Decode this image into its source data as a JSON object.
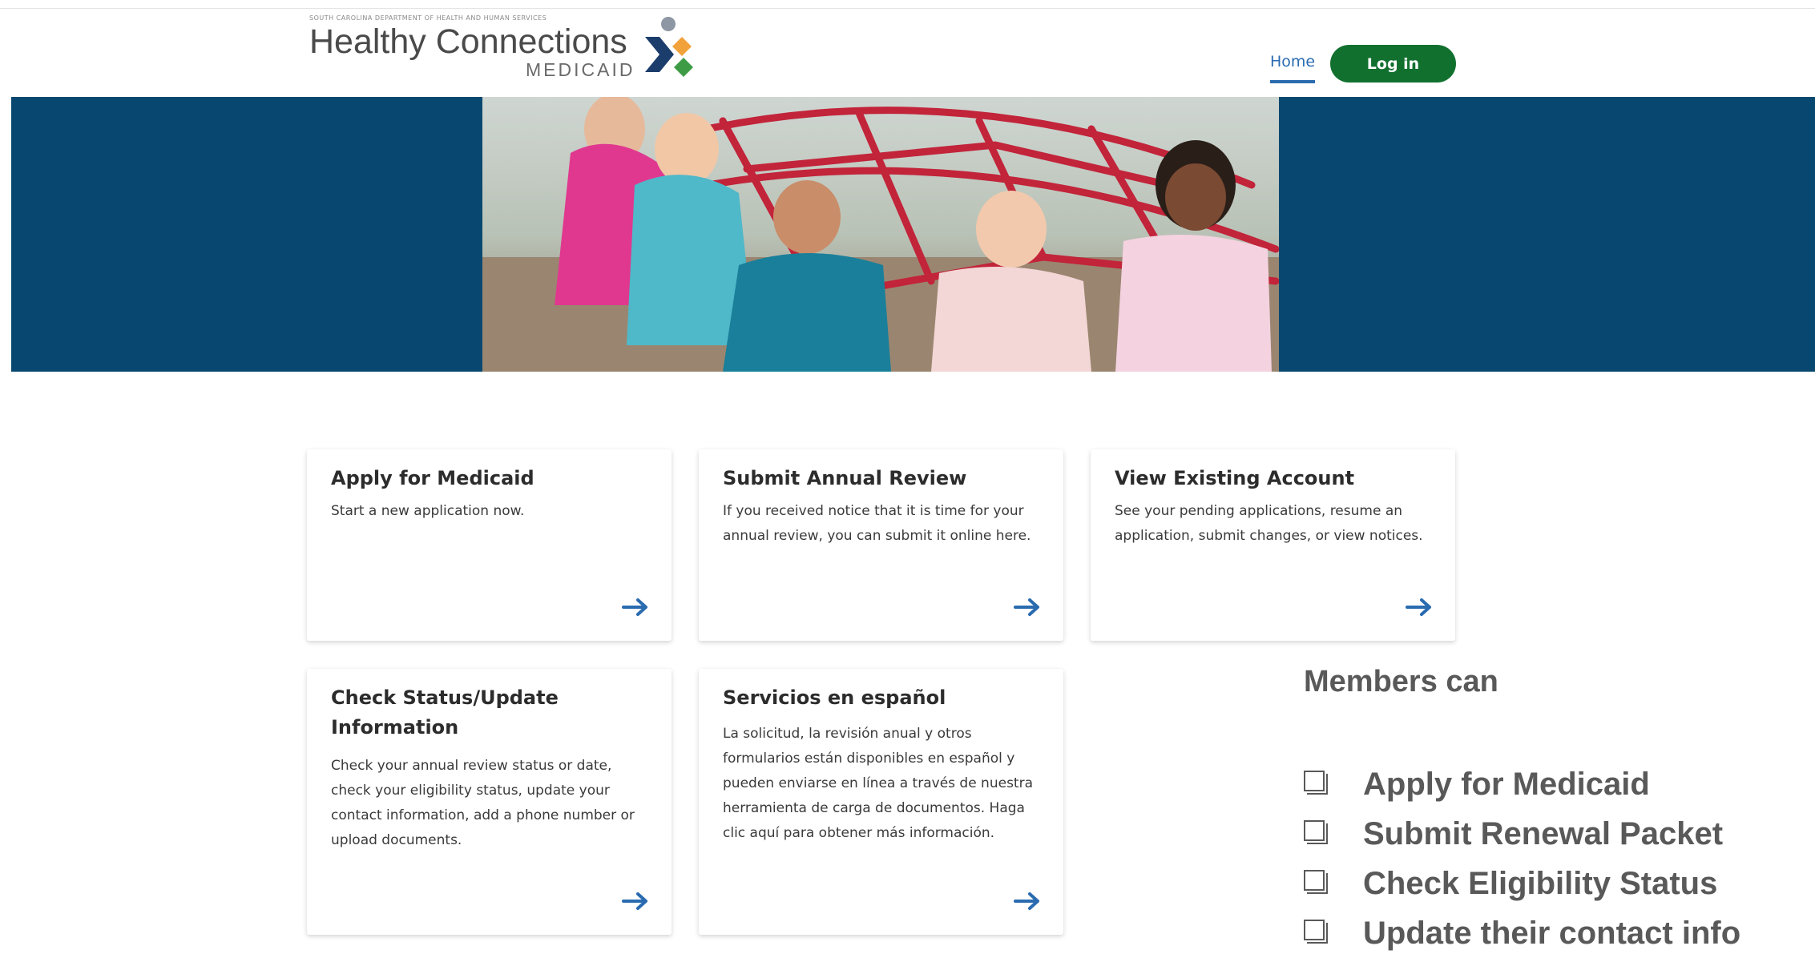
{
  "header": {
    "logo_subtitle": "SOUTH CAROLINA DEPARTMENT OF HEALTH AND HUMAN SERVICES",
    "logo_title": "Healthy Connections",
    "logo_medicaid": "MEDICAID",
    "nav_home": "Home",
    "login_label": "Log in"
  },
  "colors": {
    "banner": "#084870",
    "login_button": "#12702f",
    "link": "#2a6bb0",
    "logo_gray": "#4a4a4a",
    "logo_orange": "#f2a23a",
    "logo_green": "#3d9b46",
    "logo_navy": "#1b3d6b"
  },
  "cards": [
    {
      "title": "Apply for Medicaid",
      "desc": "Start a new application now.",
      "icon": "arrow-right-icon"
    },
    {
      "title": "Submit Annual Review",
      "desc": "If you received notice that it is time for your annual review, you can submit it online here.",
      "icon": "arrow-right-icon"
    },
    {
      "title": "View Existing Account",
      "desc": "See your pending applications, resume an application, submit changes, or view notices.",
      "icon": "arrow-right-icon"
    },
    {
      "title": "Check Status/Update Information",
      "desc": "Check your annual review status or date, check your eligibility status, update your contact information, add a phone number or upload documents.",
      "icon": "arrow-right-icon"
    },
    {
      "title": "Servicios en español",
      "desc": "La solicitud, la revisión anual y otros formularios están disponibles en español y pueden enviarse en línea a través de nuestra herramienta de carga de documentos. Haga clic aquí para obtener más información.",
      "icon": "arrow-right-icon"
    }
  ],
  "members": {
    "title": "Members can",
    "items": [
      "Apply for Medicaid",
      "Submit Renewal Packet",
      "Check Eligibility Status",
      "Update their contact info"
    ]
  }
}
